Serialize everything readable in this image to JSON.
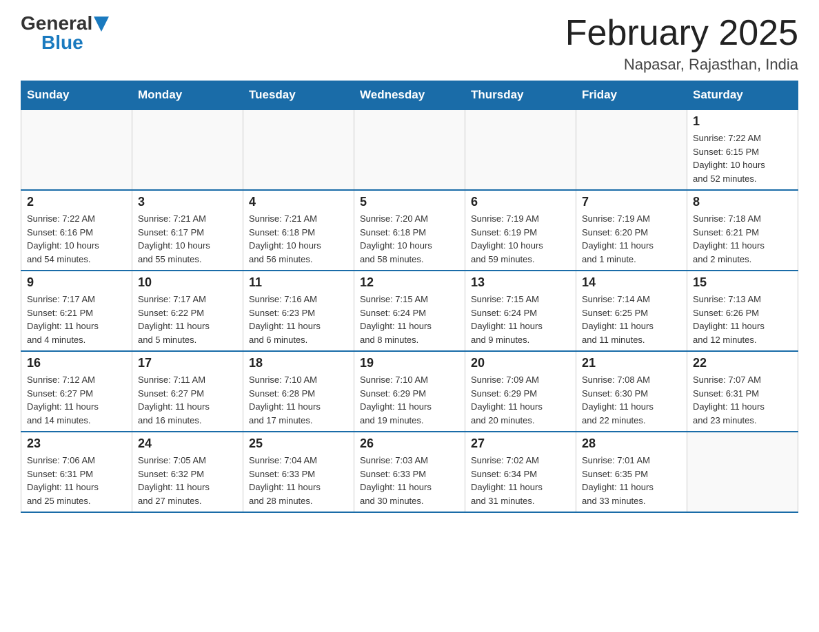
{
  "header": {
    "logo_general": "General",
    "logo_blue": "Blue",
    "month_title": "February 2025",
    "location": "Napasar, Rajasthan, India"
  },
  "weekdays": [
    "Sunday",
    "Monday",
    "Tuesday",
    "Wednesday",
    "Thursday",
    "Friday",
    "Saturday"
  ],
  "weeks": [
    [
      {
        "day": "",
        "info": ""
      },
      {
        "day": "",
        "info": ""
      },
      {
        "day": "",
        "info": ""
      },
      {
        "day": "",
        "info": ""
      },
      {
        "day": "",
        "info": ""
      },
      {
        "day": "",
        "info": ""
      },
      {
        "day": "1",
        "info": "Sunrise: 7:22 AM\nSunset: 6:15 PM\nDaylight: 10 hours\nand 52 minutes."
      }
    ],
    [
      {
        "day": "2",
        "info": "Sunrise: 7:22 AM\nSunset: 6:16 PM\nDaylight: 10 hours\nand 54 minutes."
      },
      {
        "day": "3",
        "info": "Sunrise: 7:21 AM\nSunset: 6:17 PM\nDaylight: 10 hours\nand 55 minutes."
      },
      {
        "day": "4",
        "info": "Sunrise: 7:21 AM\nSunset: 6:18 PM\nDaylight: 10 hours\nand 56 minutes."
      },
      {
        "day": "5",
        "info": "Sunrise: 7:20 AM\nSunset: 6:18 PM\nDaylight: 10 hours\nand 58 minutes."
      },
      {
        "day": "6",
        "info": "Sunrise: 7:19 AM\nSunset: 6:19 PM\nDaylight: 10 hours\nand 59 minutes."
      },
      {
        "day": "7",
        "info": "Sunrise: 7:19 AM\nSunset: 6:20 PM\nDaylight: 11 hours\nand 1 minute."
      },
      {
        "day": "8",
        "info": "Sunrise: 7:18 AM\nSunset: 6:21 PM\nDaylight: 11 hours\nand 2 minutes."
      }
    ],
    [
      {
        "day": "9",
        "info": "Sunrise: 7:17 AM\nSunset: 6:21 PM\nDaylight: 11 hours\nand 4 minutes."
      },
      {
        "day": "10",
        "info": "Sunrise: 7:17 AM\nSunset: 6:22 PM\nDaylight: 11 hours\nand 5 minutes."
      },
      {
        "day": "11",
        "info": "Sunrise: 7:16 AM\nSunset: 6:23 PM\nDaylight: 11 hours\nand 6 minutes."
      },
      {
        "day": "12",
        "info": "Sunrise: 7:15 AM\nSunset: 6:24 PM\nDaylight: 11 hours\nand 8 minutes."
      },
      {
        "day": "13",
        "info": "Sunrise: 7:15 AM\nSunset: 6:24 PM\nDaylight: 11 hours\nand 9 minutes."
      },
      {
        "day": "14",
        "info": "Sunrise: 7:14 AM\nSunset: 6:25 PM\nDaylight: 11 hours\nand 11 minutes."
      },
      {
        "day": "15",
        "info": "Sunrise: 7:13 AM\nSunset: 6:26 PM\nDaylight: 11 hours\nand 12 minutes."
      }
    ],
    [
      {
        "day": "16",
        "info": "Sunrise: 7:12 AM\nSunset: 6:27 PM\nDaylight: 11 hours\nand 14 minutes."
      },
      {
        "day": "17",
        "info": "Sunrise: 7:11 AM\nSunset: 6:27 PM\nDaylight: 11 hours\nand 16 minutes."
      },
      {
        "day": "18",
        "info": "Sunrise: 7:10 AM\nSunset: 6:28 PM\nDaylight: 11 hours\nand 17 minutes."
      },
      {
        "day": "19",
        "info": "Sunrise: 7:10 AM\nSunset: 6:29 PM\nDaylight: 11 hours\nand 19 minutes."
      },
      {
        "day": "20",
        "info": "Sunrise: 7:09 AM\nSunset: 6:29 PM\nDaylight: 11 hours\nand 20 minutes."
      },
      {
        "day": "21",
        "info": "Sunrise: 7:08 AM\nSunset: 6:30 PM\nDaylight: 11 hours\nand 22 minutes."
      },
      {
        "day": "22",
        "info": "Sunrise: 7:07 AM\nSunset: 6:31 PM\nDaylight: 11 hours\nand 23 minutes."
      }
    ],
    [
      {
        "day": "23",
        "info": "Sunrise: 7:06 AM\nSunset: 6:31 PM\nDaylight: 11 hours\nand 25 minutes."
      },
      {
        "day": "24",
        "info": "Sunrise: 7:05 AM\nSunset: 6:32 PM\nDaylight: 11 hours\nand 27 minutes."
      },
      {
        "day": "25",
        "info": "Sunrise: 7:04 AM\nSunset: 6:33 PM\nDaylight: 11 hours\nand 28 minutes."
      },
      {
        "day": "26",
        "info": "Sunrise: 7:03 AM\nSunset: 6:33 PM\nDaylight: 11 hours\nand 30 minutes."
      },
      {
        "day": "27",
        "info": "Sunrise: 7:02 AM\nSunset: 6:34 PM\nDaylight: 11 hours\nand 31 minutes."
      },
      {
        "day": "28",
        "info": "Sunrise: 7:01 AM\nSunset: 6:35 PM\nDaylight: 11 hours\nand 33 minutes."
      },
      {
        "day": "",
        "info": ""
      }
    ]
  ]
}
